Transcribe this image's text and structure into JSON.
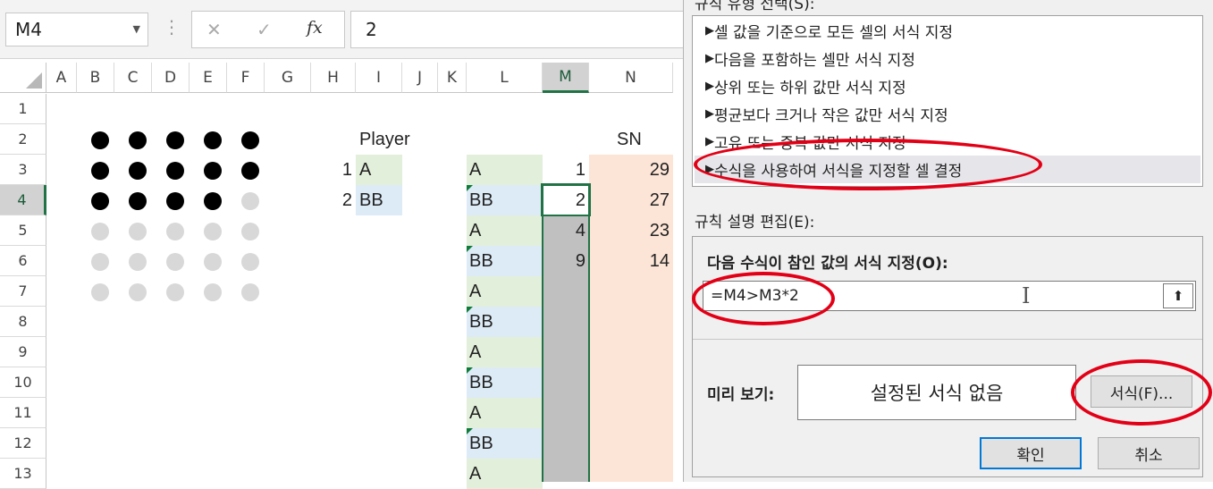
{
  "formula_bar": {
    "name_box": "M4",
    "more": "⋮",
    "cancel": "✕",
    "enter": "✓",
    "fx": "fx",
    "value": "2"
  },
  "columns": [
    "A",
    "B",
    "C",
    "D",
    "E",
    "F",
    "G",
    "H",
    "I",
    "J",
    "K",
    "L",
    "M",
    "N"
  ],
  "rows": [
    "1",
    "2",
    "3",
    "4",
    "5",
    "6",
    "7",
    "8",
    "9",
    "10",
    "11",
    "12",
    "13"
  ],
  "selected_cell": "M4",
  "dots": [
    [
      1,
      1,
      1,
      1,
      1
    ],
    [
      1,
      1,
      1,
      1,
      1
    ],
    [
      1,
      1,
      1,
      1,
      0
    ],
    [
      0,
      0,
      0,
      0,
      0
    ],
    [
      0,
      0,
      0,
      0,
      0
    ],
    [
      0,
      0,
      0,
      0,
      0
    ]
  ],
  "cells": {
    "player_header": "Player",
    "sn_header": "SN",
    "h3": "1",
    "h4": "2",
    "i3": "A",
    "i4": "BB",
    "l_values": [
      "A",
      "BB",
      "A",
      "BB",
      "A",
      "BB",
      "A",
      "BB",
      "A",
      "BB",
      "A"
    ],
    "m_values": [
      "1",
      "2",
      "4",
      "9"
    ],
    "n_values": [
      "29",
      "27",
      "23",
      "14"
    ]
  },
  "dialog": {
    "rule_type_label": "규칙 유형 선택(S):",
    "rule_types": [
      "셀 값을 기준으로 모든 셀의 서식 지정",
      "다음을 포함하는 셀만 서식 지정",
      "상위 또는 하위 값만 서식 지정",
      "평균보다 크거나 작은 값만 서식 지정",
      "고유 또는 중복 값만 서식 지정",
      "수식을 사용하여 서식을 지정할 셀 결정"
    ],
    "edit_label": "규칙 설명 편집(E):",
    "formula_label": "다음 수식이 참인 값의 서식 지정(O):",
    "formula_value": "=M4>M3*2",
    "preview_label": "미리 보기:",
    "preview_text": "설정된 서식 없음",
    "format_button": "서식(F)...",
    "ok_button": "확인",
    "cancel_button": "취소"
  },
  "colors": {
    "excel_green": "#217346",
    "annotation_red": "#e30016",
    "l_green": "#e2efda",
    "l_blue": "#ddebf7",
    "n_peach": "#fce4d6",
    "m_fill": "#c0c0c0"
  }
}
